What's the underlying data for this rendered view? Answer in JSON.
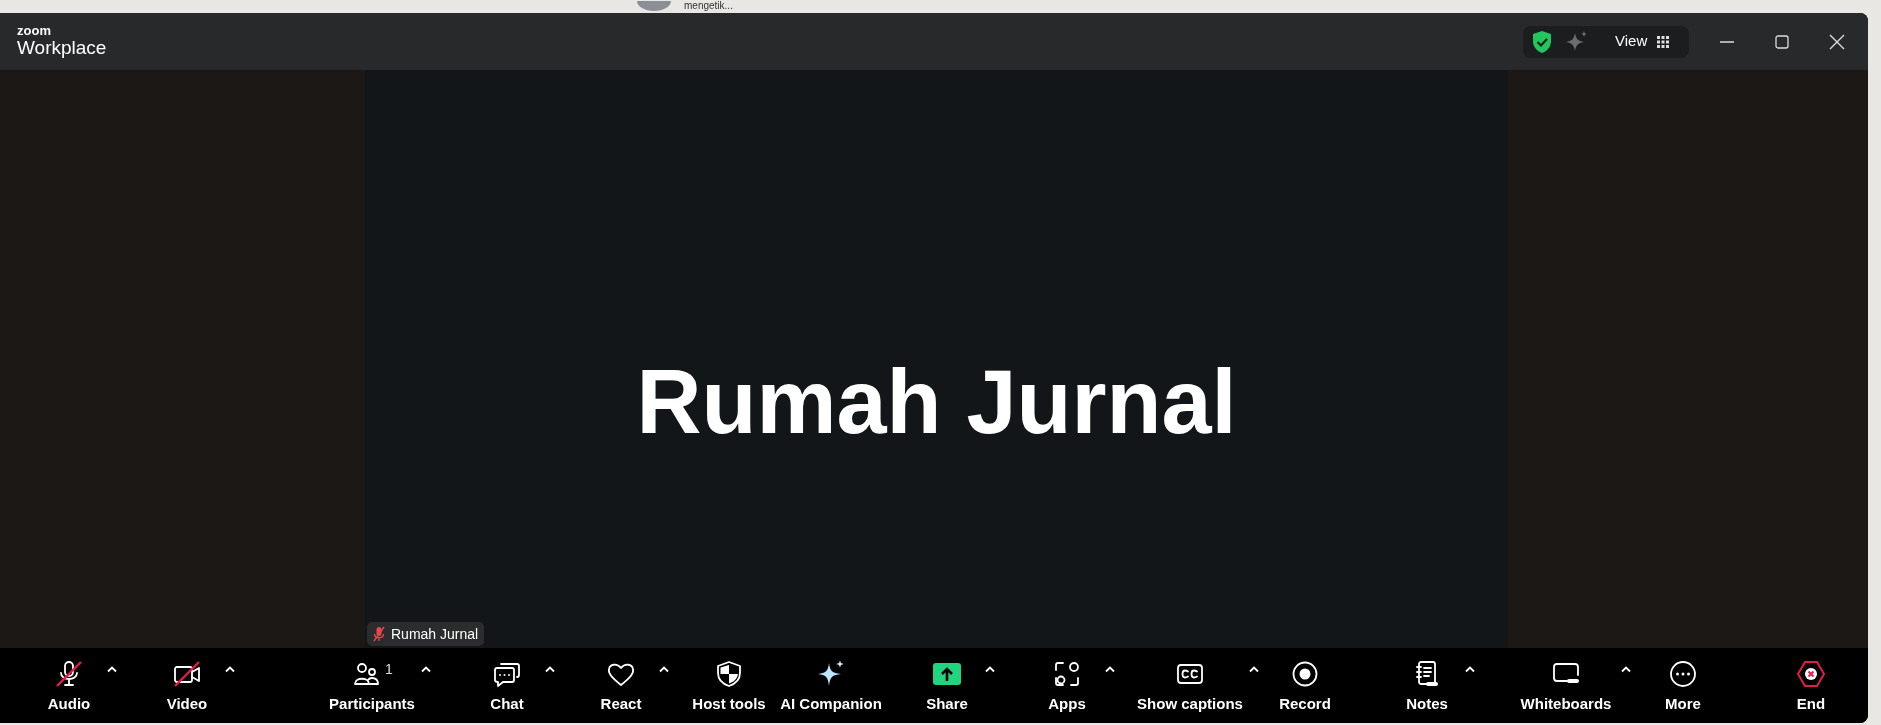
{
  "background_window": {
    "status_text": "mengetik..."
  },
  "window": {
    "logo_top": "zoom",
    "logo_bottom": "Workplace",
    "view_button": "View"
  },
  "video": {
    "title": "Rumah Jurnal",
    "name_tag": {
      "name": "Rumah Jurnal",
      "muted": true
    }
  },
  "toolbar": [
    {
      "kind": "audio",
      "label": "Audio",
      "off": true,
      "caret": true
    },
    {
      "kind": "video",
      "label": "Video",
      "off": true,
      "caret": true
    },
    {
      "kind": "participants",
      "label": "Participants",
      "count": "1",
      "caret": true
    },
    {
      "kind": "chat",
      "label": "Chat",
      "caret": true
    },
    {
      "kind": "react",
      "label": "React",
      "caret": true
    },
    {
      "kind": "host",
      "label": "Host tools",
      "caret": false
    },
    {
      "kind": "ai",
      "label": "AI Companion",
      "caret": false
    },
    {
      "kind": "share",
      "label": "Share",
      "caret": true
    },
    {
      "kind": "apps",
      "label": "Apps",
      "caret": true
    },
    {
      "kind": "captions",
      "label": "Show captions",
      "caret": true
    },
    {
      "kind": "record",
      "label": "Record",
      "caret": false
    },
    {
      "kind": "notes",
      "label": "Notes",
      "caret": true
    },
    {
      "kind": "whiteboards",
      "label": "Whiteboards",
      "caret": true
    },
    {
      "kind": "more",
      "label": "More",
      "caret": false
    },
    {
      "kind": "end",
      "label": "End",
      "caret": false
    }
  ]
}
